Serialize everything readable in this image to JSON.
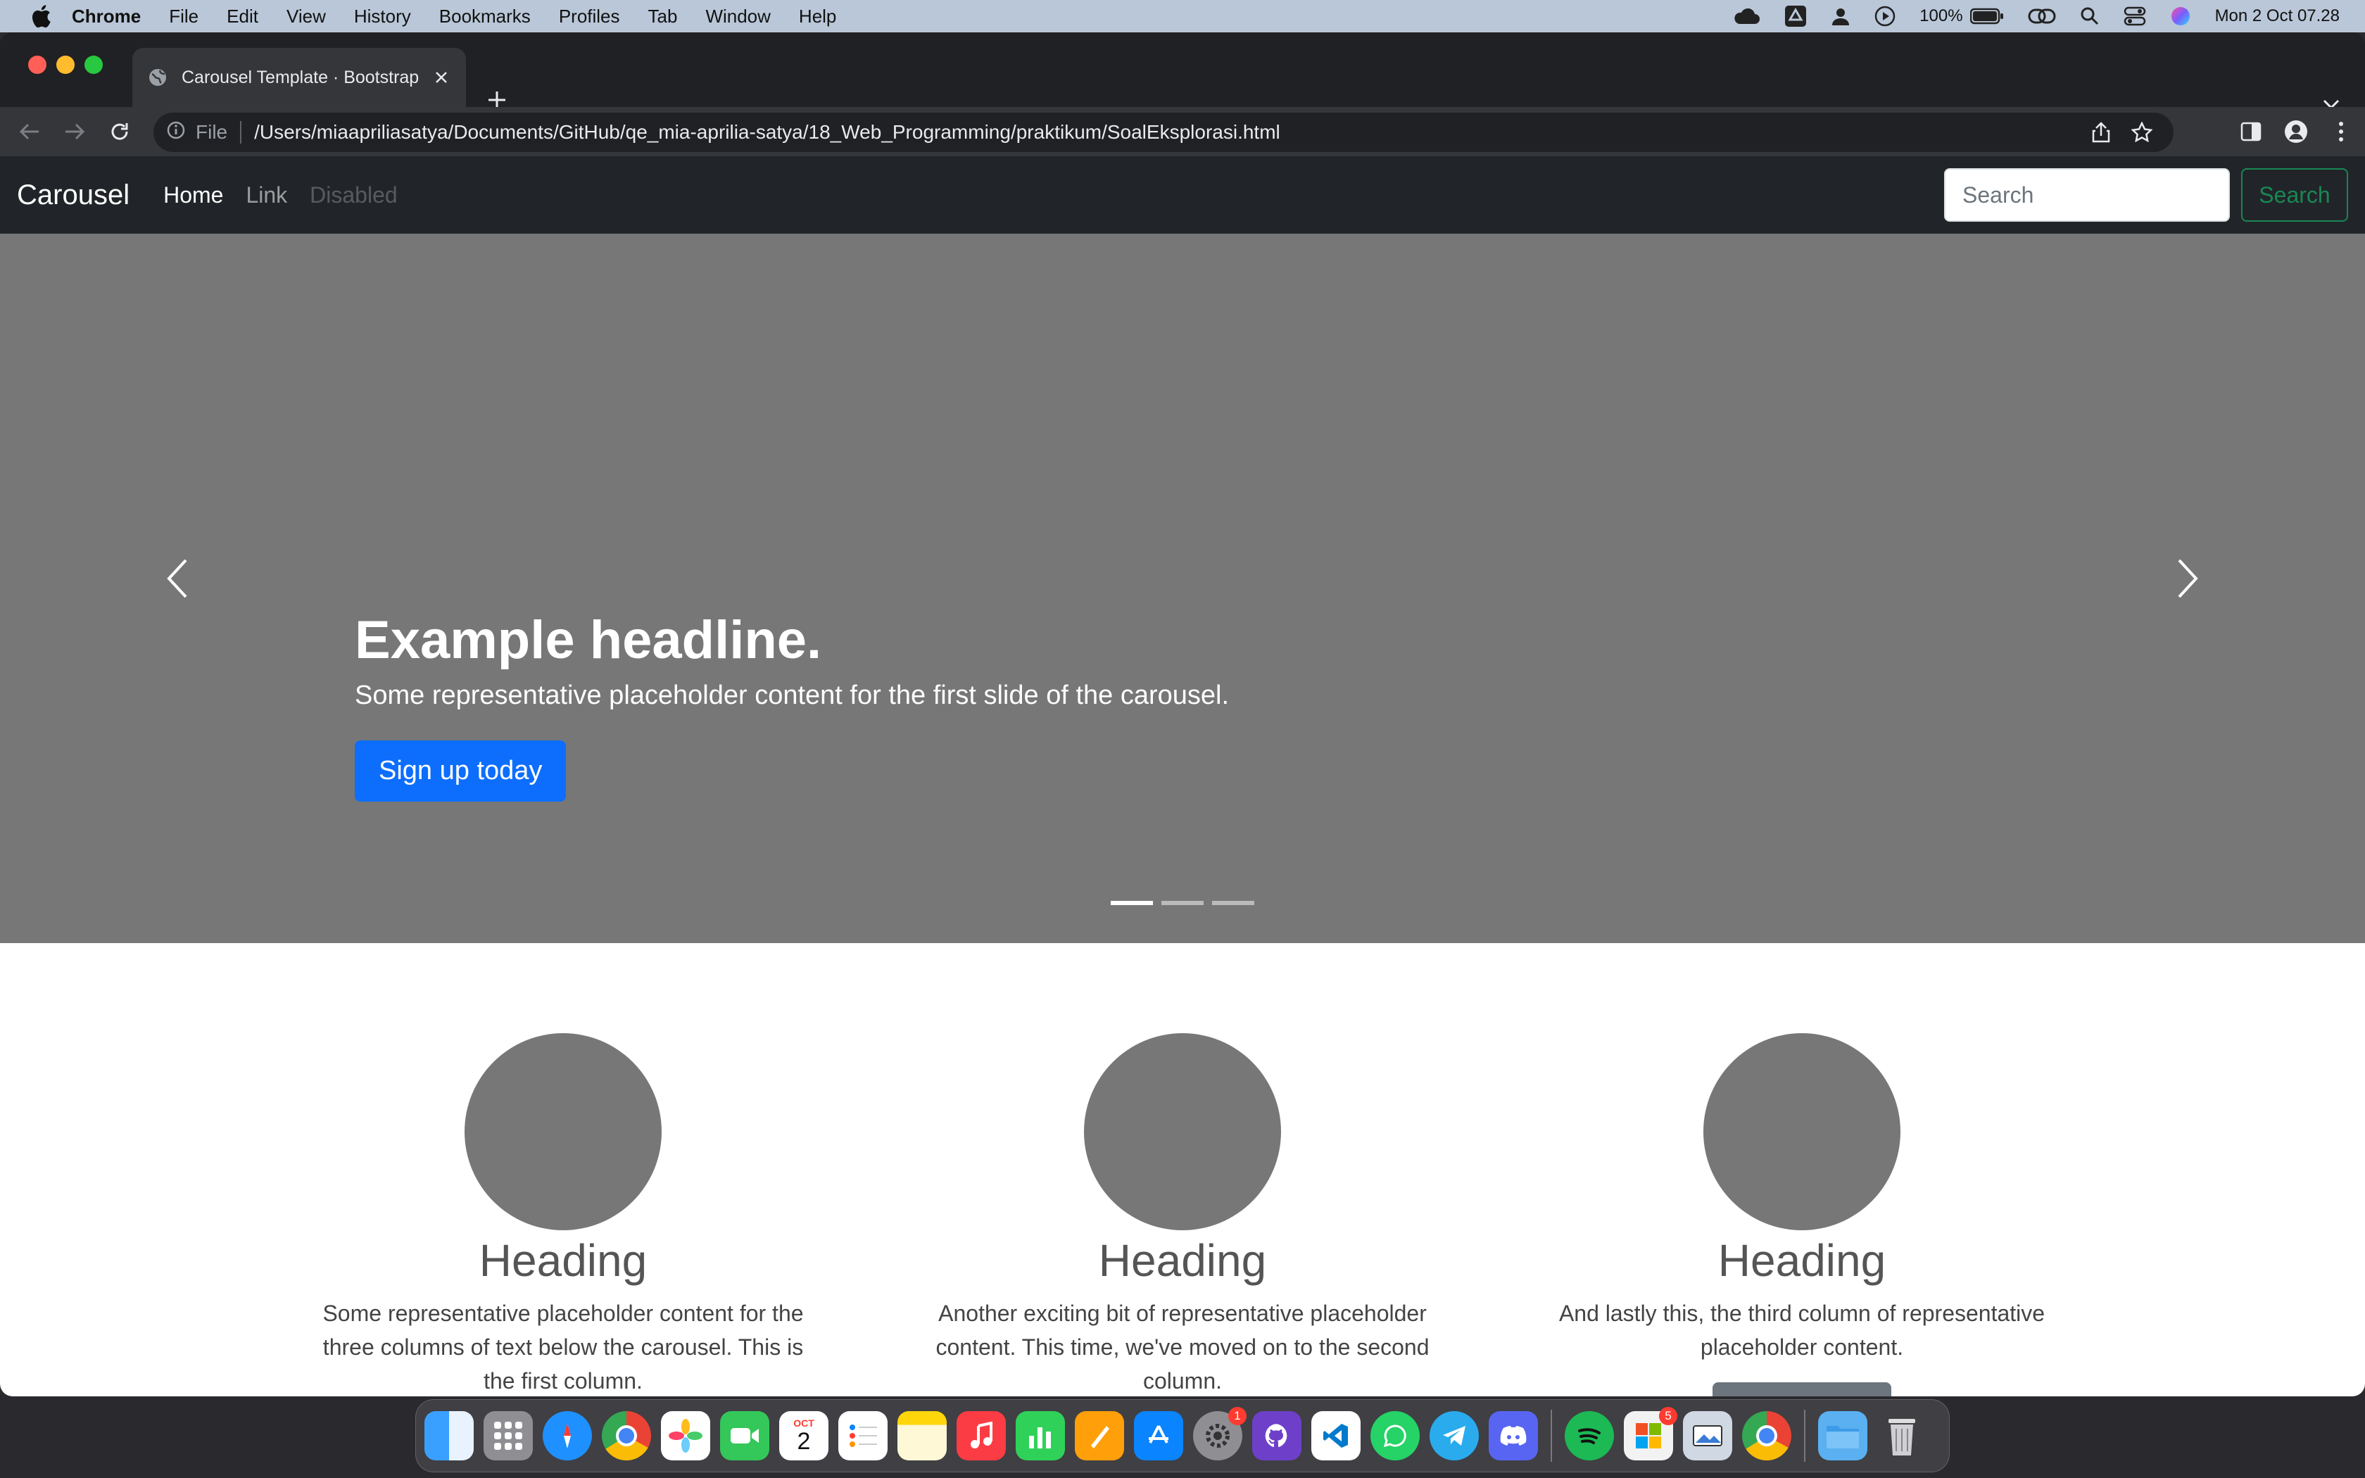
{
  "menubar": {
    "app": "Chrome",
    "items": [
      "File",
      "Edit",
      "View",
      "History",
      "Bookmarks",
      "Profiles",
      "Tab",
      "Window",
      "Help"
    ],
    "battery": "100%",
    "datetime": "Mon 2 Oct  07.28"
  },
  "browser": {
    "tab_title": "Carousel Template · Bootstrap",
    "scheme_label": "File",
    "url": "/Users/miaapriliasatya/Documents/GitHub/qe_mia-aprilia-satya/18_Web_Programming/praktikum/SoalEksplorasi.html"
  },
  "navbar": {
    "brand": "Carousel",
    "links": [
      "Home",
      "Link",
      "Disabled"
    ],
    "search_placeholder": "Search",
    "search_button": "Search"
  },
  "carousel": {
    "headline": "Example headline.",
    "text": "Some representative placeholder content for the first slide of the carousel.",
    "cta": "Sign up today",
    "slide_count": 3,
    "active_slide": 1
  },
  "columns": [
    {
      "heading": "Heading",
      "text": "Some representative placeholder content for the three columns of text below the carousel. This is the first column."
    },
    {
      "heading": "Heading",
      "text": "Another exciting bit of representative placeholder content. This time, we've moved on to the second column."
    },
    {
      "heading": "Heading",
      "text": "And lastly this, the third column of representative placeholder content."
    }
  ],
  "dock": {
    "calendar_month": "OCT",
    "calendar_day": "2",
    "badges": {
      "system-settings": "1",
      "app-badge": "5"
    }
  },
  "colors": {
    "navbar_bg": "#212529",
    "carousel_bg": "#777777",
    "primary": "#0d6efd",
    "success": "#198754"
  }
}
